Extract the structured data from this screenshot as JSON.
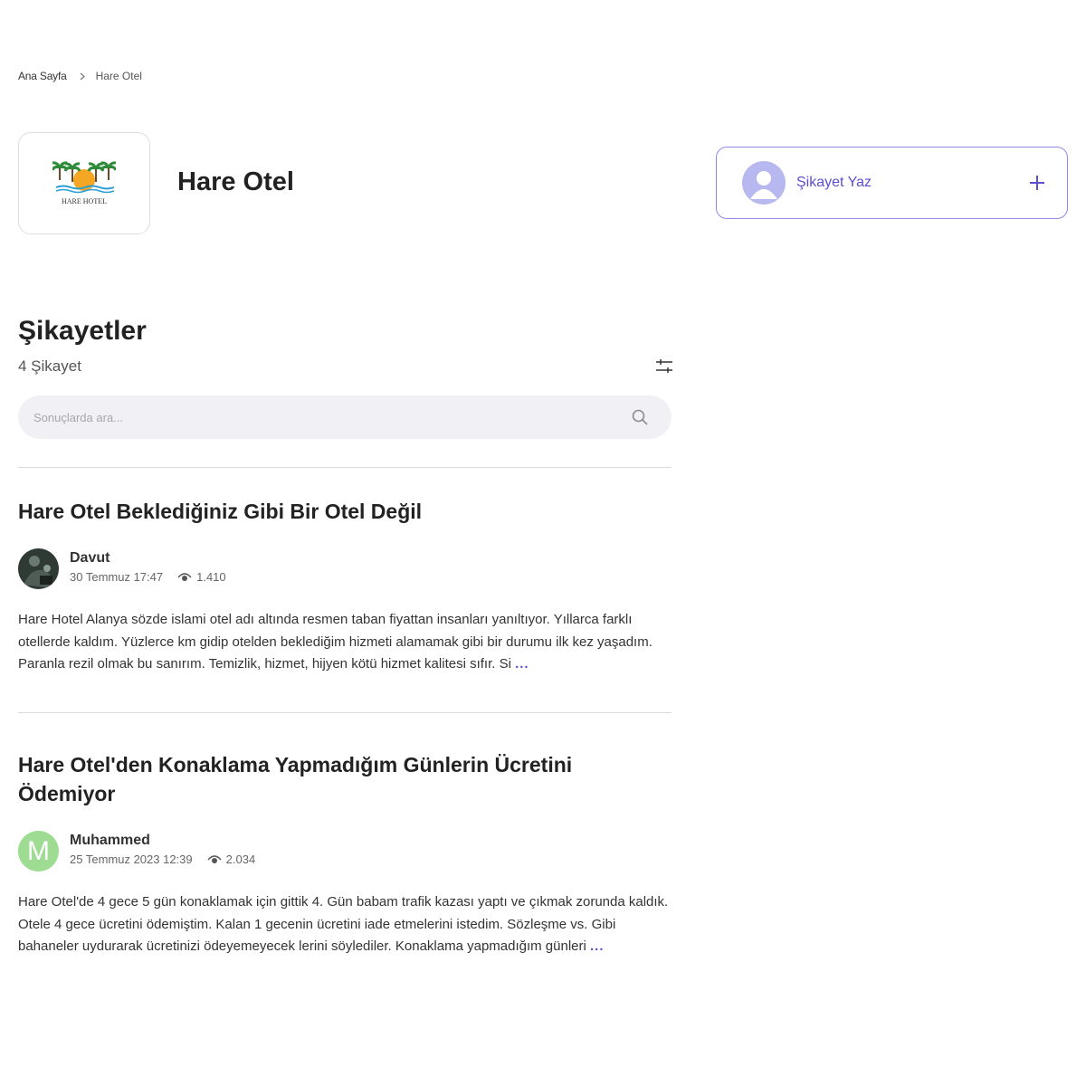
{
  "breadcrumb": {
    "home": "Ana Sayfa",
    "current": "Hare Otel"
  },
  "brand": {
    "name": "Hare Otel",
    "logo_text": "HARE HOTEL"
  },
  "write_card": {
    "label": "Şikayet Yaz",
    "icon": "plus-icon"
  },
  "complaints_section": {
    "title": "Şikayetler",
    "count_label": "4 Şikayet",
    "filter_icon": "sliders-icon",
    "search": {
      "placeholder": "Sonuçlarda ara...",
      "value": ""
    }
  },
  "complaints": [
    {
      "title": "Hare Otel Beklediğiniz Gibi Bir Otel Değil",
      "user": "Davut",
      "date": "30 Temmuz 17:47",
      "views": "1.410",
      "body": "Hare Hotel Alanya sözde islami otel adı altında resmen taban fiyattan insanları yanıltıyor. Yıllarca farklı otellerde kaldım. Yüzlerce km gidip otelden beklediğim hizmeti alamamak gibi bir durumu ilk kez yaşadım. Paranla rezil olmak bu sanırım. Temizlik, hizmet, hijyen kötü hizmet kalitesi sıfır. Si",
      "more": "..."
    },
    {
      "title": "Hare Otel'den Konaklama Yapmadığım Günlerin Ücretini Ödemiyor",
      "user": "Muhammed",
      "avatar_letter": "M",
      "date": "25 Temmuz 2023 12:39",
      "views": "2.034",
      "body": "Hare Otel'de 4 gece 5 gün konaklamak için gittik 4. Gün babam trafik kazası yaptı ve çıkmak zorunda kaldık. Otele 4 gece ücretini ödemiştim. Kalan 1 gecenin ücretini iade etmelerini istedim. Sözleşme vs. Gibi bahaneler uydurarak ücretinizi ödeyemeyecek lerini söylediler. Konaklama yapmadığım günleri",
      "more": "..."
    }
  ],
  "colors": {
    "accent": "#5b4fcf",
    "card_border": "#8d89e6",
    "avatar_placeholder": "#b6b8ef",
    "m_avatar": "#9fdc93"
  }
}
